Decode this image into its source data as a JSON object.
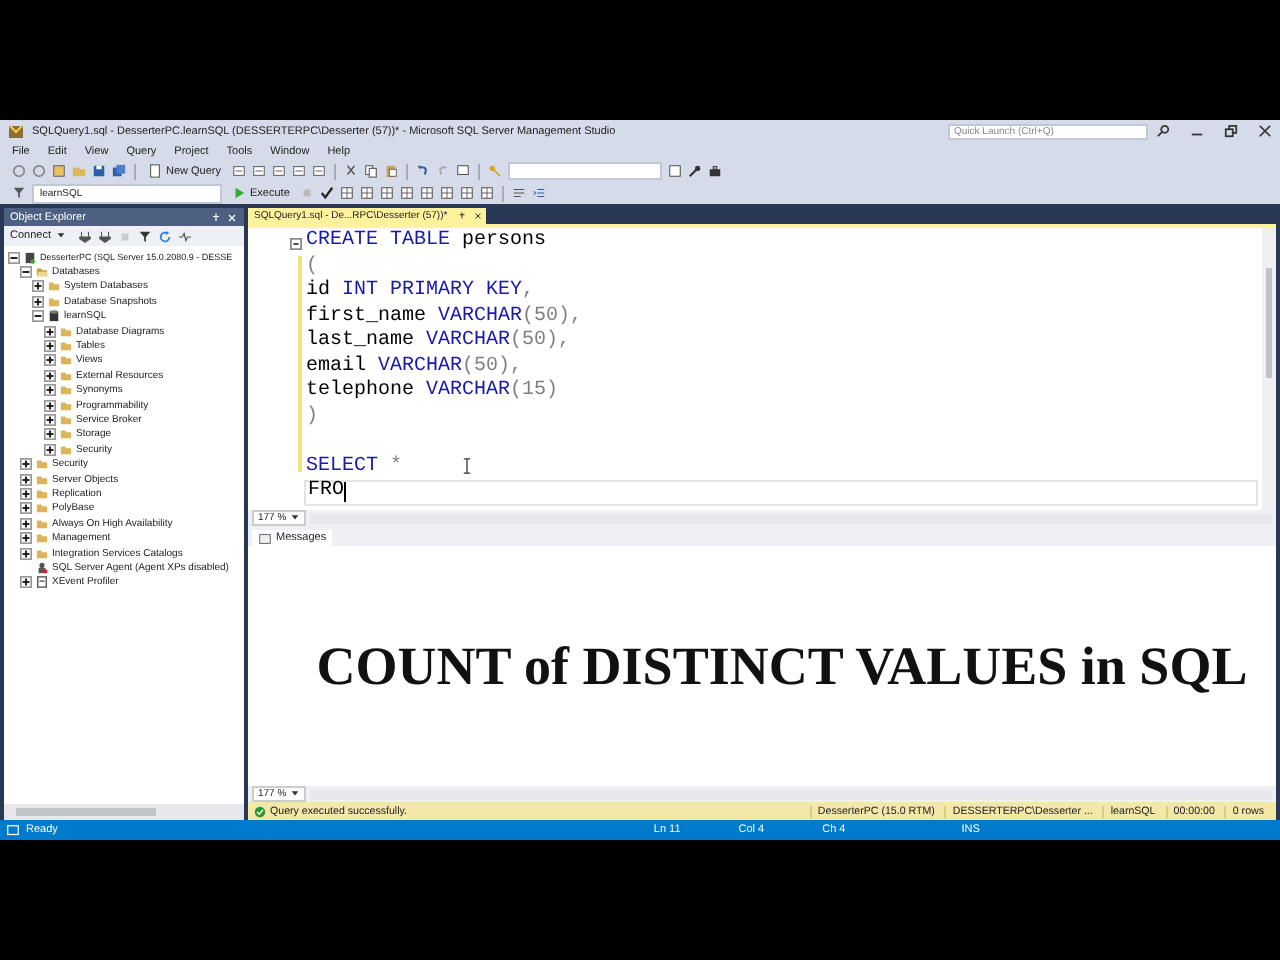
{
  "window": {
    "title": "SQLQuery1.sql - DesserterPC.learnSQL (DESSERTERPC\\Desserter (57))* - Microsoft SQL Server Management Studio",
    "quick_launch": {
      "placeholder": "Quick Launch (Ctrl+Q)"
    }
  },
  "menu": [
    "File",
    "Edit",
    "View",
    "Query",
    "Project",
    "Tools",
    "Window",
    "Help"
  ],
  "toolbar": {
    "new_query": "New Query",
    "database": "learnSQL",
    "execute": "Execute"
  },
  "object_explorer": {
    "title": "Object Explorer",
    "connect": "Connect",
    "tree": [
      {
        "label": "DesserterPC (SQL Server 15.0.2080.9 - DESSE",
        "kind": "server",
        "expanded": true,
        "children": [
          {
            "label": "Databases",
            "kind": "folder",
            "expanded": true,
            "children": [
              {
                "label": "System Databases",
                "kind": "folder",
                "expanded": false
              },
              {
                "label": "Database Snapshots",
                "kind": "folder",
                "expanded": false
              },
              {
                "label": "learnSQL",
                "kind": "database",
                "expanded": true,
                "children": [
                  {
                    "label": "Database Diagrams",
                    "kind": "folder",
                    "expanded": false
                  },
                  {
                    "label": "Tables",
                    "kind": "folder",
                    "expanded": false
                  },
                  {
                    "label": "Views",
                    "kind": "folder",
                    "expanded": false
                  },
                  {
                    "label": "External Resources",
                    "kind": "folder",
                    "expanded": false
                  },
                  {
                    "label": "Synonyms",
                    "kind": "folder",
                    "expanded": false
                  },
                  {
                    "label": "Programmability",
                    "kind": "folder",
                    "expanded": false
                  },
                  {
                    "label": "Service Broker",
                    "kind": "folder",
                    "expanded": false
                  },
                  {
                    "label": "Storage",
                    "kind": "folder",
                    "expanded": false
                  },
                  {
                    "label": "Security",
                    "kind": "folder",
                    "expanded": false
                  }
                ]
              }
            ]
          },
          {
            "label": "Security",
            "kind": "folder",
            "expanded": false
          },
          {
            "label": "Server Objects",
            "kind": "folder",
            "expanded": false
          },
          {
            "label": "Replication",
            "kind": "folder",
            "expanded": false
          },
          {
            "label": "PolyBase",
            "kind": "folder",
            "expanded": false
          },
          {
            "label": "Always On High Availability",
            "kind": "folder",
            "expanded": false
          },
          {
            "label": "Management",
            "kind": "folder",
            "expanded": false
          },
          {
            "label": "Integration Services Catalogs",
            "kind": "folder",
            "expanded": false
          },
          {
            "label": "SQL Server Agent (Agent XPs disabled)",
            "kind": "agent",
            "expanded": false
          },
          {
            "label": "XEvent Profiler",
            "kind": "profiler",
            "expanded": false
          }
        ]
      }
    ]
  },
  "editor": {
    "tab": "SQLQuery1.sql - De...RPC\\Desserter (57))*",
    "lines": [
      {
        "current": false,
        "tokens": [
          {
            "text": "CREATE TABLE",
            "kind": "keyword"
          },
          {
            "text": " persons",
            "kind": "plain"
          }
        ]
      },
      {
        "current": false,
        "tokens": [
          {
            "text": "(",
            "kind": "punct"
          }
        ]
      },
      {
        "current": false,
        "tokens": [
          {
            "text": "id ",
            "kind": "plain"
          },
          {
            "text": "INT PRIMARY KEY",
            "kind": "keyword"
          },
          {
            "text": ",",
            "kind": "punct"
          }
        ]
      },
      {
        "current": false,
        "tokens": [
          {
            "text": "first_name ",
            "kind": "plain"
          },
          {
            "text": "VARCHAR",
            "kind": "keyword"
          },
          {
            "text": "(50),",
            "kind": "punct"
          }
        ]
      },
      {
        "current": false,
        "tokens": [
          {
            "text": "last_name ",
            "kind": "plain"
          },
          {
            "text": "VARCHAR",
            "kind": "keyword"
          },
          {
            "text": "(50),",
            "kind": "punct"
          }
        ]
      },
      {
        "current": false,
        "tokens": [
          {
            "text": "email ",
            "kind": "plain"
          },
          {
            "text": "VARCHAR",
            "kind": "keyword"
          },
          {
            "text": "(50),",
            "kind": "punct"
          }
        ]
      },
      {
        "current": false,
        "tokens": [
          {
            "text": "telephone ",
            "kind": "plain"
          },
          {
            "text": "VARCHAR",
            "kind": "keyword"
          },
          {
            "text": "(15)",
            "kind": "punct"
          }
        ]
      },
      {
        "current": false,
        "tokens": [
          {
            "text": ")",
            "kind": "punct"
          }
        ]
      },
      {
        "current": false
      },
      {
        "current": false,
        "tokens": [
          {
            "text": "SELECT",
            "kind": "keyword"
          },
          {
            "text": " *",
            "kind": "punct"
          }
        ]
      },
      {
        "current": true,
        "tokens": [
          {
            "text": "FRO",
            "kind": "plain"
          }
        ]
      }
    ],
    "zoom": "177 %"
  },
  "results": {
    "tab": "Messages",
    "caption": "COUNT of DISTINCT VALUES in SQL",
    "zoom": "177 %"
  },
  "query_status": {
    "message": "Query executed successfully.",
    "server": "DesserterPC (15.0 RTM)",
    "user": "DESSERTERPC\\Desserter ...",
    "database": "learnSQL",
    "time": "00:00:00",
    "rows": "0 rows"
  },
  "status_bar": {
    "state": "Ready",
    "line": "Ln 11",
    "column": "Col 4",
    "char": "Ch 4",
    "mode": "INS"
  }
}
